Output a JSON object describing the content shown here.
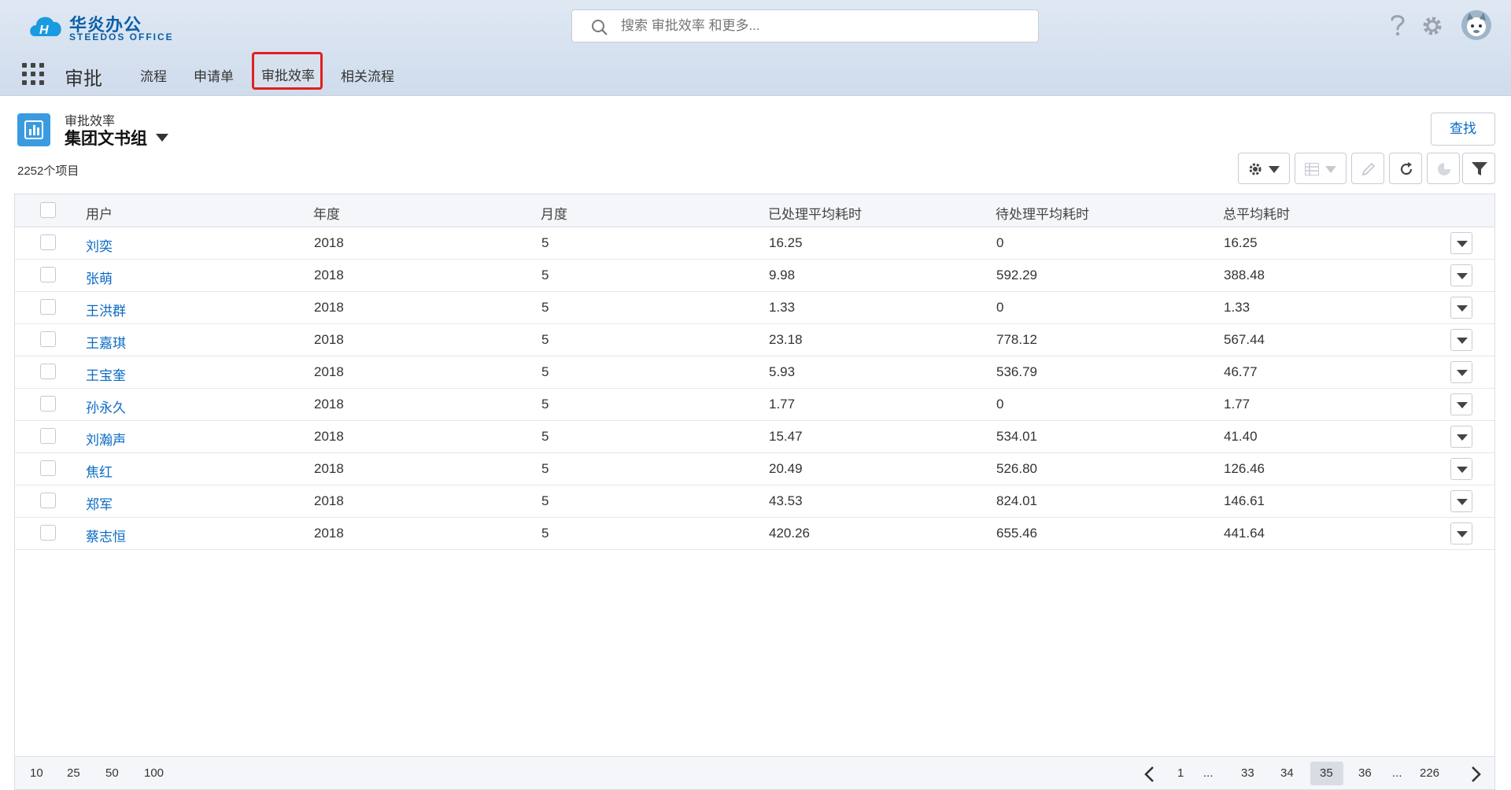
{
  "header": {
    "logo_text": "华炎办公",
    "logo_sub": "STEEDOS OFFICE",
    "search_placeholder": "搜索 审批效率 和更多...",
    "icons": [
      "help-icon",
      "settings-icon",
      "avatar"
    ]
  },
  "nav": {
    "app_name": "审批",
    "items": [
      {
        "label": "流程"
      },
      {
        "label": "申请单"
      },
      {
        "label": "审批效率",
        "active": true
      },
      {
        "label": "相关流程"
      }
    ]
  },
  "page": {
    "object_label": "审批效率",
    "view_title": "集团文书组",
    "find_button": "查找",
    "count_text": "2252个项目"
  },
  "table": {
    "headers": [
      "用户",
      "年度",
      "月度",
      "已处理平均耗时",
      "待处理平均耗时",
      "总平均耗时"
    ],
    "rows": [
      {
        "user": "刘奕",
        "year": "2018",
        "month": "5",
        "processed": "16.25",
        "pending": "0",
        "total": "16.25"
      },
      {
        "user": "张萌",
        "year": "2018",
        "month": "5",
        "processed": "9.98",
        "pending": "592.29",
        "total": "388.48"
      },
      {
        "user": "王洪群",
        "year": "2018",
        "month": "5",
        "processed": "1.33",
        "pending": "0",
        "total": "1.33"
      },
      {
        "user": "王嘉琪",
        "year": "2018",
        "month": "5",
        "processed": "23.18",
        "pending": "778.12",
        "total": "567.44"
      },
      {
        "user": "王宝奎",
        "year": "2018",
        "month": "5",
        "processed": "5.93",
        "pending": "536.79",
        "total": "46.77"
      },
      {
        "user": "孙永久",
        "year": "2018",
        "month": "5",
        "processed": "1.77",
        "pending": "0",
        "total": "1.77"
      },
      {
        "user": "刘瀚声",
        "year": "2018",
        "month": "5",
        "processed": "15.47",
        "pending": "534.01",
        "total": "41.40"
      },
      {
        "user": "焦红",
        "year": "2018",
        "month": "5",
        "processed": "20.49",
        "pending": "526.80",
        "total": "126.46"
      },
      {
        "user": "郑军",
        "year": "2018",
        "month": "5",
        "processed": "43.53",
        "pending": "824.01",
        "total": "146.61"
      },
      {
        "user": "蔡志恒",
        "year": "2018",
        "month": "5",
        "processed": "420.26",
        "pending": "655.46",
        "total": "441.64"
      }
    ]
  },
  "pagination": {
    "page_sizes": [
      "10",
      "25",
      "50",
      "100"
    ],
    "pages": [
      "1",
      "...",
      "33",
      "34",
      "35",
      "36",
      "...",
      "226"
    ],
    "current": "35"
  }
}
